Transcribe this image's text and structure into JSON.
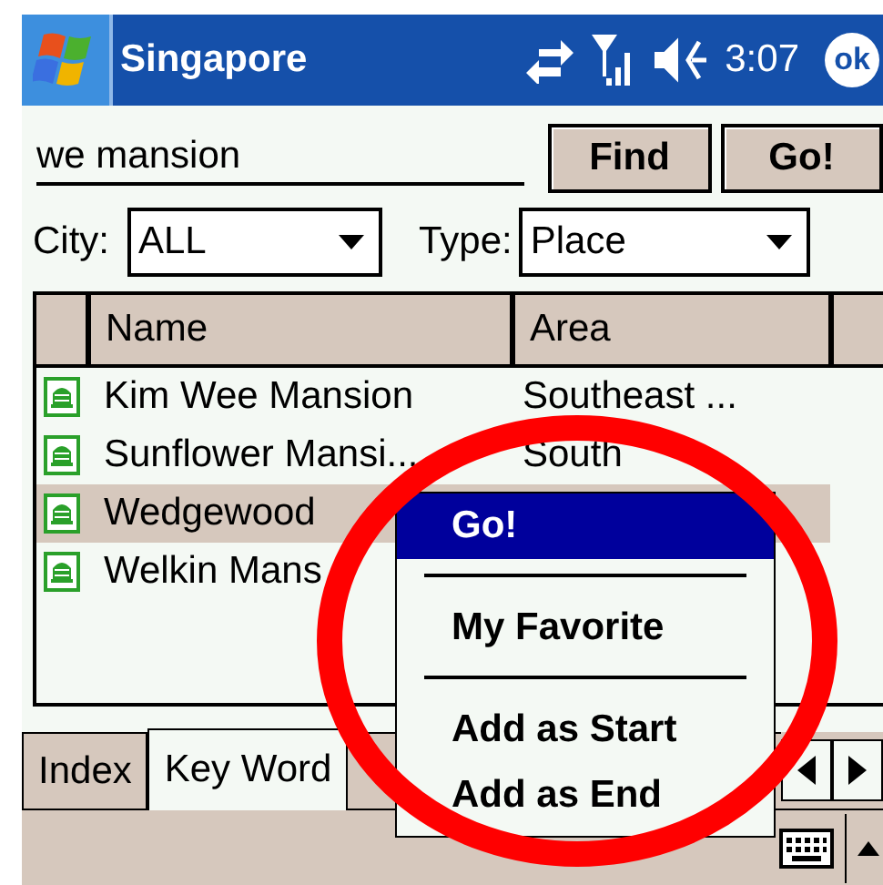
{
  "window": {
    "title": "Singapore",
    "time": "3:07",
    "ok": "ok"
  },
  "search": {
    "value": "we mansion"
  },
  "buttons": [
    "Find",
    "Go!"
  ],
  "filters": [
    {
      "label": "City:",
      "value": "ALL"
    },
    {
      "label": "Type:",
      "value": "Place"
    }
  ],
  "table": {
    "columns": [
      "Name",
      "Area"
    ],
    "rows": [
      {
        "name": "Kim Wee Mansion",
        "area": "Southeast ...",
        "selected": false
      },
      {
        "name": "Sunflower Mansi...",
        "area": "South",
        "selected": false
      },
      {
        "name": "Wedgewood",
        "selected": true
      },
      {
        "name": "Welkin Mans",
        "selected": false
      }
    ]
  },
  "tabs": [
    {
      "label": "Index",
      "selected": false
    },
    {
      "label": "Key Word",
      "selected": true
    }
  ],
  "context_menu": [
    {
      "kind": "item",
      "label": "Go!",
      "selected": true
    },
    {
      "kind": "separator"
    },
    {
      "kind": "item",
      "label": "My Favorite",
      "selected": false
    },
    {
      "kind": "separator"
    },
    {
      "kind": "item",
      "label": "Add as Start",
      "selected": false
    },
    {
      "kind": "item",
      "label": "Add as End",
      "selected": false
    }
  ],
  "annotations": [
    {
      "kind": "circle"
    }
  ]
}
